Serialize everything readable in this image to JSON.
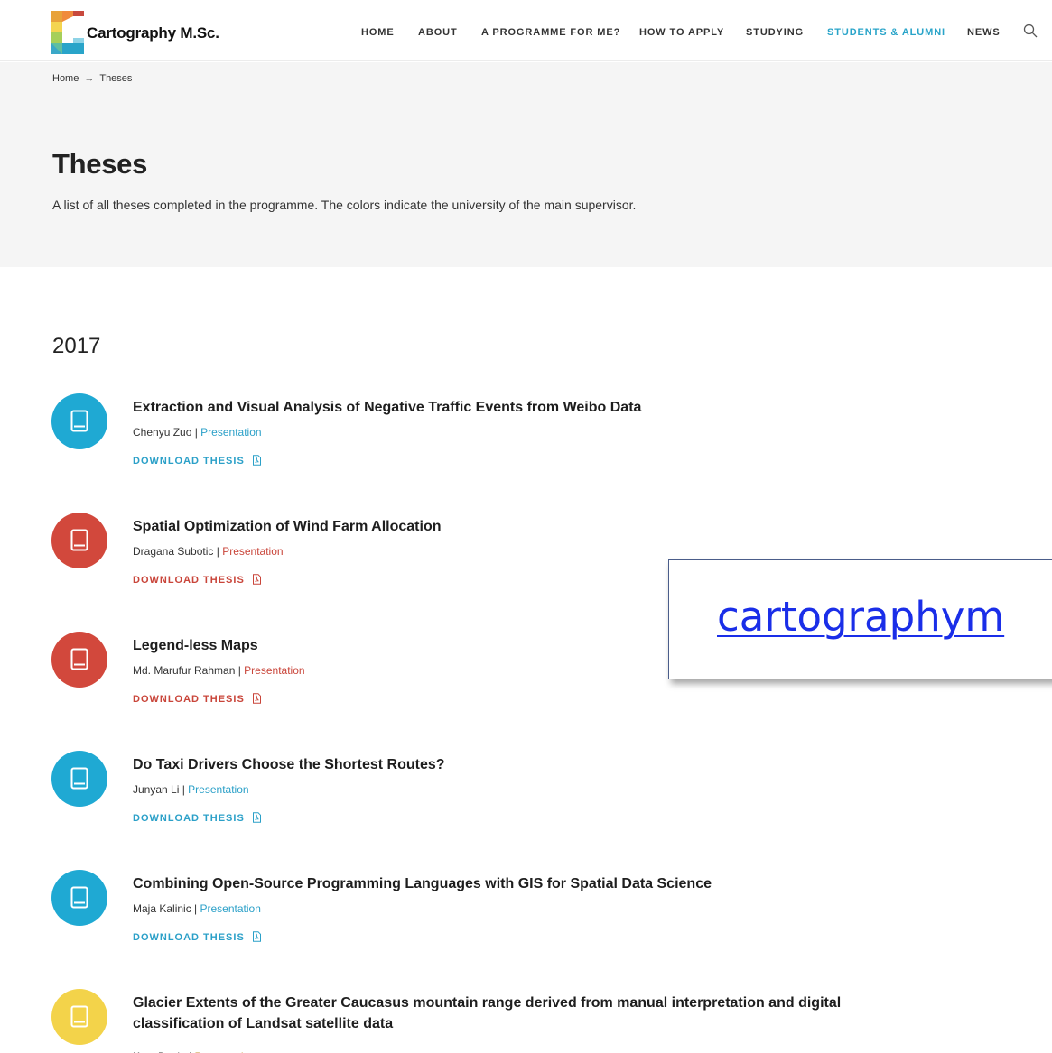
{
  "site": {
    "name": "Cartography M.Sc."
  },
  "nav": {
    "items": [
      "HOME",
      "ABOUT",
      "A PROGRAMME FOR ME?",
      "HOW TO APPLY",
      "STUDYING",
      "STUDENTS & ALUMNI",
      "NEWS"
    ],
    "active": "STUDENTS & ALUMNI"
  },
  "breadcrumb": {
    "home": "Home",
    "separator": "→",
    "current": "Theses"
  },
  "page": {
    "title": "Theses",
    "description": "A list of all theses completed in the programme. The colors indicate the university of the main supervisor."
  },
  "year": "2017",
  "download_label": "DOWNLOAD THESIS",
  "presentation_label": "Presentation",
  "colors": {
    "blue": "#1fa9d3",
    "red": "#d2483c",
    "yellow": "#f3d34a",
    "blue_text": "#2ba0c8",
    "red_text": "#c9453a",
    "yellow_text": "#c4922a",
    "nav_active": "#29a4c9"
  },
  "theses": [
    {
      "title": "Extraction and Visual Analysis of Negative Traffic Events from Weibo Data",
      "author": "Chenyu Zuo",
      "color": "blue"
    },
    {
      "title": "Spatial Optimization of Wind Farm Allocation",
      "author": "Dragana Subotic",
      "color": "red"
    },
    {
      "title": "Legend-less Maps",
      "author": "Md. Marufur Rahman",
      "color": "red"
    },
    {
      "title": "Do Taxi Drivers Choose the Shortest Routes?",
      "author": "Junyan Li",
      "color": "blue"
    },
    {
      "title": "Combining Open-Source Programming Languages with GIS for Spatial Data Science",
      "author": "Maja Kalinic",
      "color": "blue"
    },
    {
      "title": "Glacier Extents of the Greater Caucasus mountain range derived from manual interpretation and digital classification of Landsat satellite data",
      "author": "Kate Doyle",
      "color": "yellow"
    }
  ],
  "overlay": {
    "text": "cartographym"
  }
}
